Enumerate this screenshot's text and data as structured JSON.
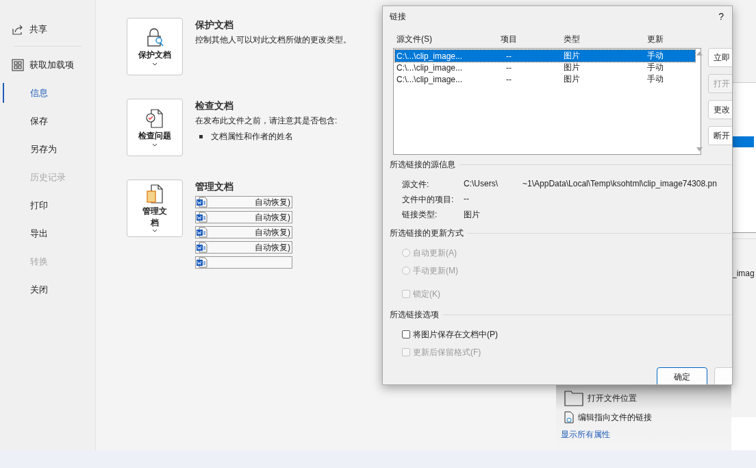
{
  "sidebar": {
    "items": [
      {
        "label": "共享",
        "kind": "share",
        "selected": false,
        "disabled": false
      },
      {
        "label": "获取加载项",
        "kind": "grid",
        "selected": false,
        "disabled": false,
        "divider_before": true
      },
      {
        "label": "信息",
        "selected": true,
        "disabled": false
      },
      {
        "label": "保存",
        "selected": false,
        "disabled": false
      },
      {
        "label": "另存为",
        "selected": false,
        "disabled": false
      },
      {
        "label": "历史记录",
        "selected": false,
        "disabled": true
      },
      {
        "label": "打印",
        "selected": false,
        "disabled": false
      },
      {
        "label": "导出",
        "selected": false,
        "disabled": false
      },
      {
        "label": "转换",
        "selected": false,
        "disabled": true
      },
      {
        "label": "关闭",
        "selected": false,
        "disabled": false
      }
    ]
  },
  "sections": [
    {
      "kind": "protect",
      "button": "保护文档",
      "title": "保护文档",
      "description": "控制其他人可以对此文档所做的更改类型。"
    },
    {
      "kind": "inspect",
      "button": "检查问题",
      "title": "检查文档",
      "description": "在发布此文件之前，请注意其是否包含:",
      "bullets": [
        "文档属性和作者的姓名"
      ]
    },
    {
      "kind": "manage",
      "button": "管理文档",
      "title": "管理文档",
      "versions": [
        {
          "kind": "named",
          "text": "自动恢复)"
        },
        {
          "kind": "named",
          "text": "自动恢复)"
        },
        {
          "kind": "named",
          "text": "自动恢复)"
        },
        {
          "kind": "named",
          "text": "自动恢复)"
        },
        {
          "kind": "blank"
        }
      ]
    }
  ],
  "related": [
    {
      "kind": "folder",
      "label": "打开文件位置"
    },
    {
      "kind": "link",
      "label": "编辑指向文件的链接"
    }
  ],
  "show_all_link": "显示所有属性",
  "dialog": {
    "title": "链接",
    "help": "?",
    "columns": [
      "源文件(S)",
      "项目",
      "类型",
      "更新"
    ],
    "rows": [
      {
        "source": "C:\\...\\clip_image...",
        "item": "--",
        "type": "图片",
        "update": "手动",
        "selected": true
      },
      {
        "source": "C:\\...\\clip_image...",
        "item": "--",
        "type": "图片",
        "update": "手动",
        "selected": false
      },
      {
        "source": "C:\\...\\clip_image...",
        "item": "--",
        "type": "图片",
        "update": "手动",
        "selected": false
      }
    ],
    "side_buttons": [
      {
        "label": "立即",
        "disabled": false
      },
      {
        "label": "打开",
        "disabled": true
      },
      {
        "label": "更改",
        "disabled": false
      },
      {
        "label": "断开",
        "disabled": false
      }
    ],
    "source_info": {
      "heading": "所选链接的源信息",
      "fields": [
        {
          "label": "源文件:",
          "value": "C:\\Users\\",
          "value_end": "~1\\AppData\\Local\\Temp\\ksohtml\\clip_image74308.pn"
        },
        {
          "label": "文件中的项目:",
          "value": "--"
        },
        {
          "label": "链接类型:",
          "value": "图片"
        }
      ]
    },
    "update_method": {
      "heading": "所选链接的更新方式",
      "radios": [
        {
          "label": "自动更新(A)",
          "selected": false,
          "disabled": true
        },
        {
          "label": "手动更新(M)",
          "selected": false,
          "disabled": true
        }
      ],
      "lock": {
        "label": "锁定(K)",
        "checked": false,
        "disabled": true
      }
    },
    "options": {
      "heading": "所选链接选项",
      "checkboxes": [
        {
          "label": "将图片保存在文档中(P)",
          "checked": false,
          "disabled": false
        },
        {
          "label": "更新后保留格式(F)",
          "checked": false,
          "disabled": true
        }
      ]
    },
    "ok": "确定"
  },
  "back_window": {
    "text": "_imag"
  }
}
